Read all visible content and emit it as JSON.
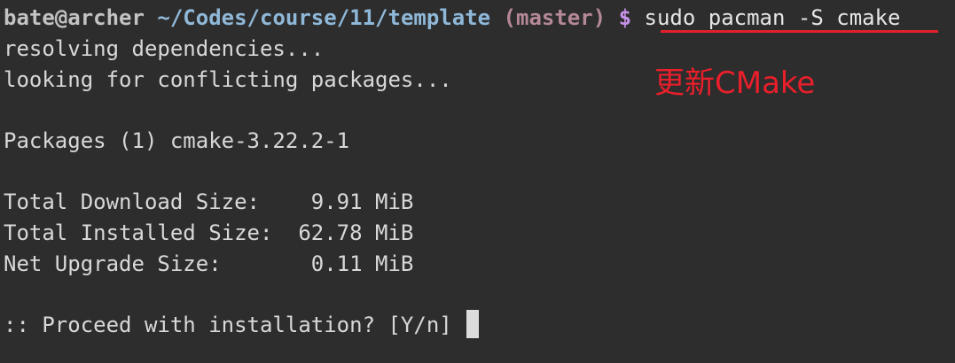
{
  "prompt": {
    "user_host": "bate@archer",
    "path": "~/Codes/course/11/template",
    "branch": "(master)",
    "symbol": "$",
    "command": "sudo pacman -S cmake"
  },
  "output": {
    "resolving": "resolving dependencies...",
    "conflicting": "looking for conflicting packages...",
    "packages": "Packages (1) cmake-3.22.2-1",
    "download_size": "Total Download Size:    9.91 MiB",
    "installed_size": "Total Installed Size:  62.78 MiB",
    "upgrade_size": "Net Upgrade Size:       0.11 MiB",
    "proceed": ":: Proceed with installation? [Y/n] "
  },
  "annotation": {
    "text": "更新CMake",
    "color": "#ea1f2b"
  },
  "colors": {
    "background": "#2d2d2d",
    "text": "#d8d8d8",
    "path": "#8fb8d8",
    "branch": "#b58898",
    "dollar": "#c792ea",
    "underline": "#e4212b"
  }
}
